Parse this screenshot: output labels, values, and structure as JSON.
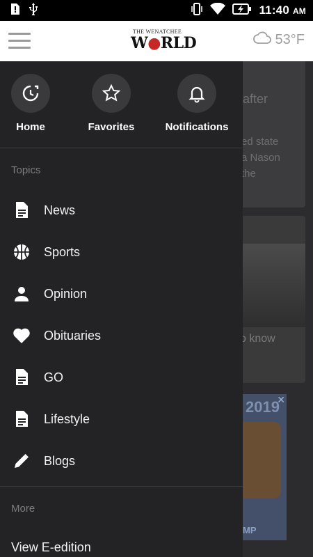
{
  "status": {
    "time": "11:40",
    "ampm": "AM"
  },
  "header": {
    "logo_small": "THE WENATCHEE",
    "logo_big_pre": "W",
    "logo_big_post": "RLD",
    "temperature": "53°F"
  },
  "background": {
    "card1_title": "after",
    "card1_text_1": "ed state",
    "card1_text_2": "a Nason",
    "card1_text_3": "the",
    "card2_text": "o know",
    "ad_year": "2019",
    "ad_label": "MP"
  },
  "drawer": {
    "quick": [
      {
        "label": "Home",
        "icon": "home-refresh-icon"
      },
      {
        "label": "Favorites",
        "icon": "star-icon"
      },
      {
        "label": "Notifications",
        "icon": "bell-icon"
      }
    ],
    "topics_label": "Topics",
    "topics": [
      {
        "label": "News",
        "icon": "document-icon"
      },
      {
        "label": "Sports",
        "icon": "basketball-icon"
      },
      {
        "label": "Opinion",
        "icon": "person-icon"
      },
      {
        "label": "Obituaries",
        "icon": "heart-icon"
      },
      {
        "label": "GO",
        "icon": "document-icon"
      },
      {
        "label": "Lifestyle",
        "icon": "document-icon"
      },
      {
        "label": "Blogs",
        "icon": "pencil-icon"
      }
    ],
    "more_label": "More",
    "eedition": "View E-edition"
  }
}
